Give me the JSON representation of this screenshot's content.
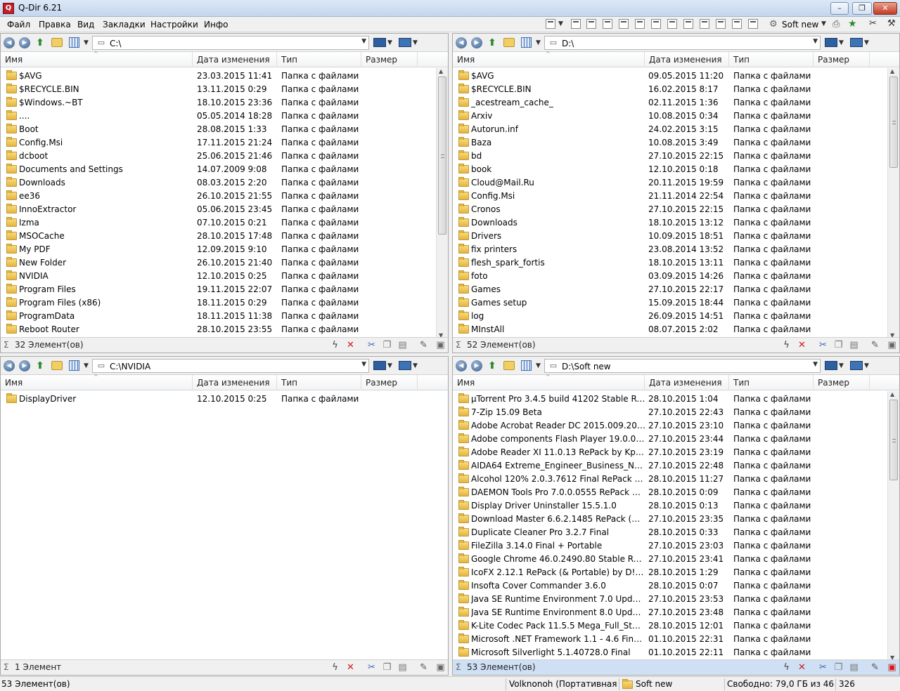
{
  "window": {
    "title": "Q-Dir 6.21",
    "icon": "Q"
  },
  "window_buttons": {
    "minimize": "–",
    "restore": "❐",
    "close": "✕"
  },
  "menu": [
    "Файл",
    "Правка",
    "Вид",
    "Закладки",
    "Настройки",
    "Инфо"
  ],
  "toolbar": {
    "profile": "Soft new"
  },
  "columns": {
    "name": "Имя",
    "date": "Дата изменения",
    "type": "Тип",
    "size": "Размер"
  },
  "panes": [
    {
      "path": "C:\\",
      "count": "32 Элемент(ов)",
      "active": false,
      "items": [
        [
          "$AVG",
          "23.03.2015 11:41",
          "Папка с файлами"
        ],
        [
          "$RECYCLE.BIN",
          "13.11.2015 0:29",
          "Папка с файлами"
        ],
        [
          "$Windows.~BT",
          "18.10.2015 23:36",
          "Папка с файлами"
        ],
        [
          "....",
          "05.05.2014 18:28",
          "Папка с файлами"
        ],
        [
          "Boot",
          "28.08.2015 1:33",
          "Папка с файлами"
        ],
        [
          "Config.Msi",
          "17.11.2015 21:24",
          "Папка с файлами"
        ],
        [
          "dcboot",
          "25.06.2015 21:46",
          "Папка с файлами"
        ],
        [
          "Documents and Settings",
          "14.07.2009 9:08",
          "Папка с файлами"
        ],
        [
          "Downloads",
          "08.03.2015 2:20",
          "Папка с файлами"
        ],
        [
          "ee36",
          "26.10.2015 21:55",
          "Папка с файлами"
        ],
        [
          "InnoExtractor",
          "05.06.2015 23:45",
          "Папка с файлами"
        ],
        [
          "Izma",
          "07.10.2015 0:21",
          "Папка с файлами"
        ],
        [
          "MSOCache",
          "28.10.2015 17:48",
          "Папка с файлами"
        ],
        [
          "My PDF",
          "12.09.2015 9:10",
          "Папка с файлами"
        ],
        [
          "New Folder",
          "26.10.2015 21:40",
          "Папка с файлами"
        ],
        [
          "NVIDIA",
          "12.10.2015 0:25",
          "Папка с файлами"
        ],
        [
          "Program Files",
          "19.11.2015 22:07",
          "Папка с файлами"
        ],
        [
          "Program Files (x86)",
          "18.11.2015 0:29",
          "Папка с файлами"
        ],
        [
          "ProgramData",
          "18.11.2015 11:38",
          "Папка с файлами"
        ],
        [
          "Reboot Router",
          "28.10.2015 23:55",
          "Папка с файлами"
        ]
      ]
    },
    {
      "path": "D:\\",
      "count": "52 Элемент(ов)",
      "active": false,
      "items": [
        [
          "$AVG",
          "09.05.2015 11:20",
          "Папка с файлами"
        ],
        [
          "$RECYCLE.BIN",
          "16.02.2015 8:17",
          "Папка с файлами"
        ],
        [
          "_acestream_cache_",
          "02.11.2015 1:36",
          "Папка с файлами"
        ],
        [
          "Arxiv",
          "10.08.2015 0:34",
          "Папка с файлами"
        ],
        [
          "Autorun.inf",
          "24.02.2015 3:15",
          "Папка с файлами"
        ],
        [
          "Baza",
          "10.08.2015 3:49",
          "Папка с файлами"
        ],
        [
          "bd",
          "27.10.2015 22:15",
          "Папка с файлами"
        ],
        [
          "book",
          "12.10.2015 0:18",
          "Папка с файлами"
        ],
        [
          "Cloud@Mail.Ru",
          "20.11.2015 19:59",
          "Папка с файлами"
        ],
        [
          "Config.Msi",
          "21.11.2014 22:54",
          "Папка с файлами"
        ],
        [
          "Cronos",
          "27.10.2015 22:15",
          "Папка с файлами"
        ],
        [
          "Downloads",
          "18.10.2015 13:12",
          "Папка с файлами"
        ],
        [
          "Drivers",
          "10.09.2015 18:51",
          "Папка с файлами"
        ],
        [
          "fix printers",
          "23.08.2014 13:52",
          "Папка с файлами"
        ],
        [
          "flesh_spark_fortis",
          "18.10.2015 13:11",
          "Папка с файлами"
        ],
        [
          "foto",
          "03.09.2015 14:26",
          "Папка с файлами"
        ],
        [
          "Games",
          "27.10.2015 22:17",
          "Папка с файлами"
        ],
        [
          "Games setup",
          "15.09.2015 18:44",
          "Папка с файлами"
        ],
        [
          "log",
          "26.09.2015 14:51",
          "Папка с файлами"
        ],
        [
          "MInstAll",
          "08.07.2015 2:02",
          "Папка с файлами"
        ]
      ]
    },
    {
      "path": "C:\\NVIDIA",
      "count": "1 Элемент",
      "active": false,
      "items": [
        [
          "DisplayDriver",
          "12.10.2015 0:25",
          "Папка с файлами"
        ]
      ]
    },
    {
      "path": "D:\\Soft new",
      "count": "53 Элемент(ов)",
      "active": true,
      "items": [
        [
          "µTorrent Pro 3.4.5 build 41202 Stable RePack...",
          "28.10.2015 1:04",
          "Папка с файлами"
        ],
        [
          "7-Zip 15.09 Beta",
          "27.10.2015 22:43",
          "Папка с файлами"
        ],
        [
          "Adobe Acrobat Reader DC 2015.009.20069 R...",
          "27.10.2015 23:10",
          "Папка с файлами"
        ],
        [
          "Adobe components  Flash Player 19.0.0.226 ...",
          "27.10.2015 23:44",
          "Папка с файлами"
        ],
        [
          "Adobe Reader XI 11.0.13 RePack by KpoJIuK",
          "27.10.2015 23:19",
          "Папка с файлами"
        ],
        [
          "AIDA64 Extreme_Engineer_Business_Networ...",
          "27.10.2015 22:48",
          "Папка с файлами"
        ],
        [
          "Alcohol 120% 2.0.3.7612 Final RePack by Kp...",
          "28.10.2015 11:27",
          "Папка с файлами"
        ],
        [
          "DAEMON Tools Pro 7.0.0.0555 RePack by Kp...",
          "28.10.2015 0:09",
          "Папка с файлами"
        ],
        [
          "Display Driver Uninstaller 15.5.1.0",
          "28.10.2015 0:13",
          "Папка с файлами"
        ],
        [
          "Download Master 6.6.2.1485 RePack (& Port...",
          "27.10.2015 23:35",
          "Папка с файлами"
        ],
        [
          "Duplicate Cleaner Pro 3.2.7 Final",
          "28.10.2015 0:33",
          "Папка с файлами"
        ],
        [
          "FileZilla 3.14.0 Final + Portable",
          "27.10.2015 23:03",
          "Папка с файлами"
        ],
        [
          "Google Chrome 46.0.2490.80 Stable RePack (...",
          "27.10.2015 23:41",
          "Папка с файлами"
        ],
        [
          "IcoFX 2.12.1 RePack (& Portable) by D!akov",
          "28.10.2015 1:29",
          "Папка с файлами"
        ],
        [
          "Insofta Cover Commander 3.6.0",
          "28.10.2015 0:07",
          "Папка с файлами"
        ],
        [
          "Java SE Runtime Environment 7.0 Update 79...",
          "27.10.2015 23:53",
          "Папка с файлами"
        ],
        [
          "Java SE Runtime Environment 8.0 Update 66 ...",
          "27.10.2015 23:48",
          "Папка с файлами"
        ],
        [
          "K-Lite Codec Pack 11.5.5 Mega_Full_Standar...",
          "28.10.2015 12:01",
          "Папка с файлами"
        ],
        [
          "Microsoft .NET Framework 1.1 - 4.6 Final Re...",
          "01.10.2015 22:31",
          "Папка с файлами"
        ],
        [
          "Microsoft Silverlight 5.1.40728.0 Final",
          "01.10.2015 22:11",
          "Папка с файлами"
        ]
      ]
    }
  ],
  "statusbar": {
    "selection": "53 Элемент(ов)",
    "user": "Volknonoh (Портативная вер",
    "folder": "Soft new",
    "free": "Свободно: 79,0 ГБ из 465 ГБ",
    "num": "326"
  },
  "colors": {
    "accent": "#3f6fb5",
    "active_status": "#cfe0f4",
    "folder": "#e4b440"
  }
}
